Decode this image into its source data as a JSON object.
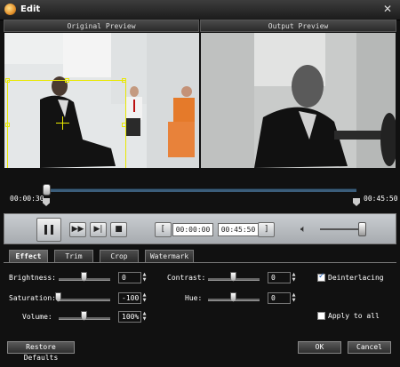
{
  "window": {
    "title": "Edit"
  },
  "preview": {
    "original_label": "Original Preview",
    "output_label": "Output Preview"
  },
  "timeline": {
    "start_time": "00:00:30",
    "end_time": "00:45:50",
    "playhead_fraction": 0.0
  },
  "playback": {
    "pause_label": "Pause",
    "range_start": "00:00:00",
    "range_end": "00:45:50",
    "volume_fraction": 0.9
  },
  "tabs": [
    "Effect",
    "Trim",
    "Crop",
    "Watermark"
  ],
  "effect": {
    "brightness": {
      "label": "Brightness:",
      "value": "0",
      "fraction": 0.5
    },
    "contrast": {
      "label": "Contrast:",
      "value": "0",
      "fraction": 0.5
    },
    "saturation": {
      "label": "Saturation:",
      "value": "-100",
      "fraction": 0.0
    },
    "hue": {
      "label": "Hue:",
      "value": "0",
      "fraction": 0.5
    },
    "volume": {
      "label": "Volume:",
      "value": "100%",
      "fraction": 0.5
    },
    "deinterlacing": {
      "label": "Deinterlacing",
      "checked": true
    },
    "apply_to_all": {
      "label": "Apply to all",
      "checked": false
    }
  },
  "buttons": {
    "restore": "Restore Defaults",
    "ok": "OK",
    "cancel": "Cancel"
  },
  "colors": {
    "accent": "#e8e800",
    "track": "#3b5d7a"
  }
}
